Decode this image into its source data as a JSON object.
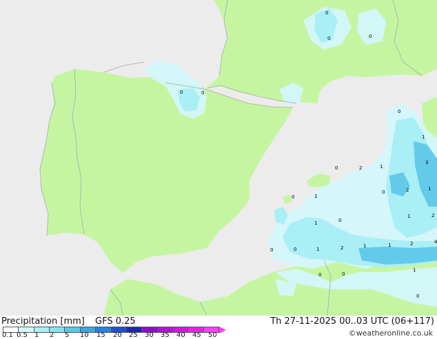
{
  "footer": {
    "title": "Precipitation [mm]",
    "model": "GFS 0.25",
    "datetime": "Th 27-11-2025 00..03 UTC (06+117)",
    "credit": "©weatheronline.co.uk"
  },
  "legend": {
    "ticks": [
      "0.1",
      "0.5",
      "1",
      "2",
      "5",
      "10",
      "15",
      "20",
      "25",
      "30",
      "35",
      "40",
      "45",
      "50"
    ],
    "colors": [
      "#ffffff",
      "#d4f7fb",
      "#aaeef6",
      "#88e2f0",
      "#5cc8e8",
      "#3aa8e0",
      "#2a80dc",
      "#2050c8",
      "#1a2aa0",
      "#8a10c8",
      "#b014d0",
      "#d418d8",
      "#f020e0",
      "#ff40f0"
    ]
  },
  "colors": {
    "sea": "#ececec",
    "land": "#c6f5a2",
    "border": "#a8a8a8",
    "precip_light": "#d4f7fb",
    "precip_mid": "#aaeef6",
    "precip_heavy": "#5cc8e8"
  },
  "labels": [
    "0",
    "0",
    "0",
    "0",
    "0",
    "1",
    "3",
    "1",
    "0",
    "1",
    "0",
    "2",
    "1",
    "0",
    "1",
    "0",
    "1",
    "0",
    "2",
    "2",
    "0",
    "0",
    "1",
    "2",
    "1",
    "1",
    "2",
    "4",
    "1",
    "0",
    "0",
    "0"
  ]
}
